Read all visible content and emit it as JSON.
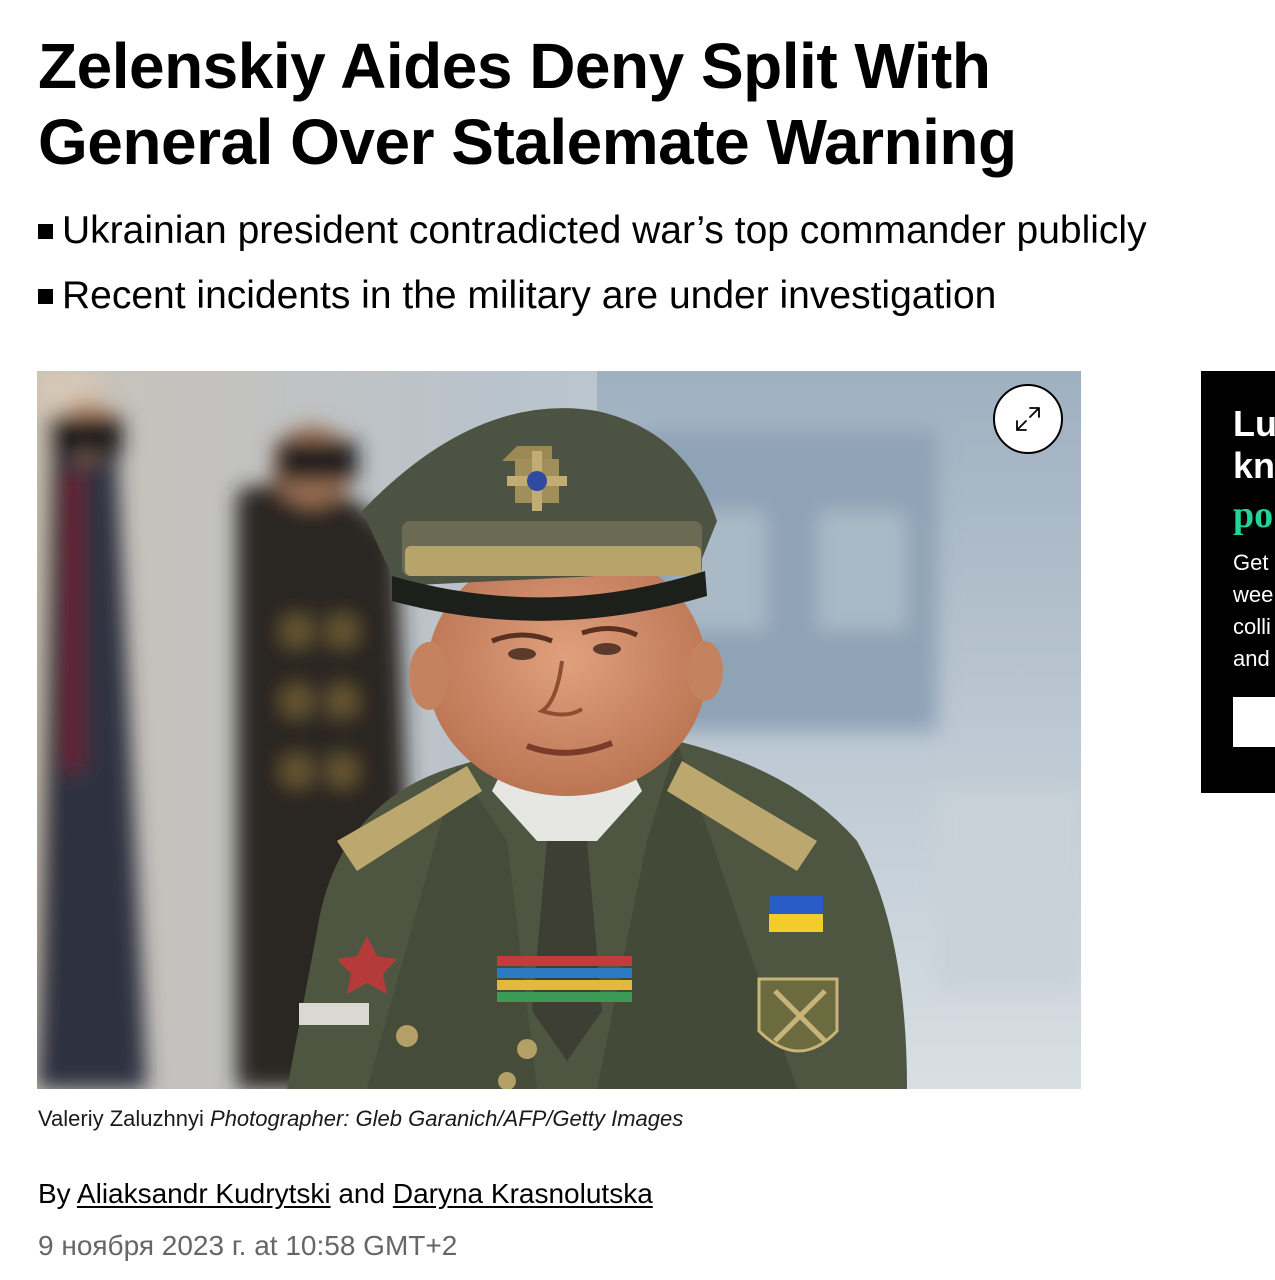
{
  "article": {
    "headline_line1": "Zelenskiy Aides Deny Split With",
    "headline_line2": "General Over Stalemate Warning",
    "bullets": [
      "Ukrainian president contradicted war’s top commander publicly",
      "Recent incidents in the military are under investigation"
    ],
    "photo": {
      "subject": "Valeriy Zaluzhnyi",
      "credit": "Photographer: Gleb Garanich/AFP/Getty Images",
      "expand_icon": "expand-arrows-icon"
    },
    "byline": {
      "prefix": "By",
      "author1": "Aliaksandr Kudrytski",
      "conjunction": "and",
      "author2": "Daryna Krasnolutska"
    },
    "timestamp": "9 ноября 2023 г. at 10:58 GMT+2"
  },
  "ad": {
    "title_line1": "Lu",
    "title_line2": "kn",
    "accent_text": "po",
    "body_lines": [
      "Get",
      "wee",
      "colli",
      "and"
    ],
    "accent_color": "#22d49a"
  },
  "colors": {
    "text": "#000000",
    "muted": "#666666",
    "ad_background": "#000000"
  }
}
